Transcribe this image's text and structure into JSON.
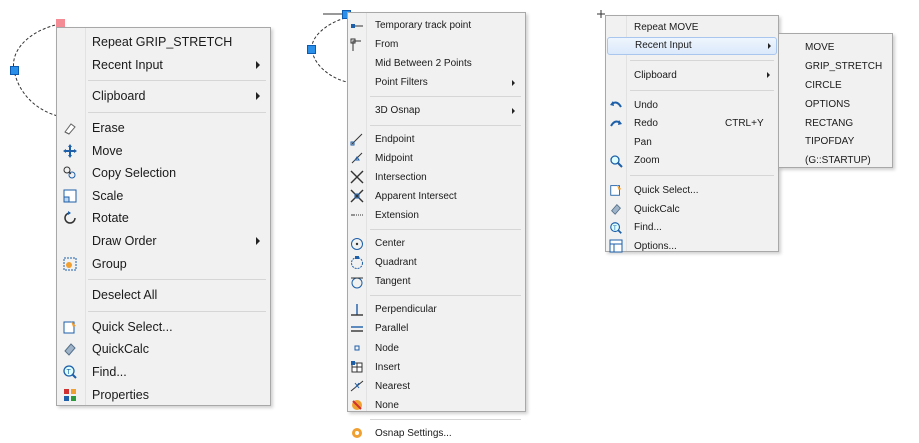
{
  "menu_grip": {
    "items": [
      {
        "type": "item",
        "label": "Repeat GRIP_STRETCH",
        "icon": null
      },
      {
        "type": "item",
        "label": "Recent Input",
        "submenu": true,
        "icon": null
      },
      {
        "type": "separator"
      },
      {
        "type": "item",
        "label": "Clipboard",
        "submenu": true,
        "icon": null
      },
      {
        "type": "separator"
      },
      {
        "type": "item",
        "label": "Erase",
        "icon": "erase-icon"
      },
      {
        "type": "item",
        "label": "Move",
        "icon": "move-icon"
      },
      {
        "type": "item",
        "label": "Copy Selection",
        "icon": "copy-selection-icon"
      },
      {
        "type": "item",
        "label": "Scale",
        "icon": "scale-icon"
      },
      {
        "type": "item",
        "label": "Rotate",
        "icon": "rotate-icon"
      },
      {
        "type": "item",
        "label": "Draw Order",
        "submenu": true,
        "icon": null
      },
      {
        "type": "item",
        "label": "Group",
        "icon": "group-icon"
      },
      {
        "type": "separator"
      },
      {
        "type": "item",
        "label": "Deselect All",
        "icon": null
      },
      {
        "type": "separator"
      },
      {
        "type": "item",
        "label": "Quick Select...",
        "icon": "quick-select-icon"
      },
      {
        "type": "item",
        "label": "QuickCalc",
        "icon": "quickcalc-icon"
      },
      {
        "type": "item",
        "label": "Find...",
        "icon": "find-icon"
      },
      {
        "type": "item",
        "label": "Properties",
        "icon": "properties-icon"
      }
    ]
  },
  "menu_osnap": {
    "items": [
      {
        "type": "item",
        "label": "Temporary track point",
        "icon": "temporary-track-point-icon"
      },
      {
        "type": "item",
        "label": "From",
        "icon": "from-icon"
      },
      {
        "type": "item",
        "label": "Mid Between 2 Points",
        "icon": null
      },
      {
        "type": "item",
        "label": "Point Filters",
        "submenu": true,
        "icon": null
      },
      {
        "type": "separator"
      },
      {
        "type": "item",
        "label": "3D Osnap",
        "submenu": true,
        "icon": null
      },
      {
        "type": "separator"
      },
      {
        "type": "item",
        "label": "Endpoint",
        "icon": "endpoint-icon"
      },
      {
        "type": "item",
        "label": "Midpoint",
        "icon": "midpoint-icon"
      },
      {
        "type": "item",
        "label": "Intersection",
        "icon": "intersection-icon"
      },
      {
        "type": "item",
        "label": "Apparent Intersect",
        "icon": "apparent-intersect-icon"
      },
      {
        "type": "item",
        "label": "Extension",
        "icon": "extension-icon"
      },
      {
        "type": "separator"
      },
      {
        "type": "item",
        "label": "Center",
        "icon": "center-icon"
      },
      {
        "type": "item",
        "label": "Quadrant",
        "icon": "quadrant-icon"
      },
      {
        "type": "item",
        "label": "Tangent",
        "icon": "tangent-icon"
      },
      {
        "type": "separator"
      },
      {
        "type": "item",
        "label": "Perpendicular",
        "icon": "perpendicular-icon"
      },
      {
        "type": "item",
        "label": "Parallel",
        "icon": "parallel-icon"
      },
      {
        "type": "item",
        "label": "Node",
        "icon": "node-icon"
      },
      {
        "type": "item",
        "label": "Insert",
        "icon": "insert-icon"
      },
      {
        "type": "item",
        "label": "Nearest",
        "icon": "nearest-icon"
      },
      {
        "type": "item",
        "label": "None",
        "icon": "none-icon"
      },
      {
        "type": "separator"
      },
      {
        "type": "item",
        "label": "Osnap Settings...",
        "icon": "osnap-settings-icon"
      }
    ]
  },
  "menu_default": {
    "items": [
      {
        "type": "item",
        "label": "Repeat MOVE",
        "icon": null
      },
      {
        "type": "item",
        "label": "Recent Input",
        "submenu": true,
        "highlighted": true,
        "icon": null
      },
      {
        "type": "separator"
      },
      {
        "type": "item",
        "label": "Clipboard",
        "submenu": true,
        "icon": null
      },
      {
        "type": "separator"
      },
      {
        "type": "item",
        "label": "Undo",
        "icon": "undo-icon"
      },
      {
        "type": "item",
        "label": "Redo",
        "shortcut": "CTRL+Y",
        "icon": "redo-icon"
      },
      {
        "type": "item",
        "label": "Pan",
        "icon": null
      },
      {
        "type": "item",
        "label": "Zoom",
        "icon": "zoom-icon"
      },
      {
        "type": "separator"
      },
      {
        "type": "item",
        "label": "Quick Select...",
        "icon": "quick-select-icon"
      },
      {
        "type": "item",
        "label": "QuickCalc",
        "icon": "quickcalc-icon"
      },
      {
        "type": "item",
        "label": "Find...",
        "icon": "find-icon"
      },
      {
        "type": "item",
        "label": "Options...",
        "icon": "options-icon"
      }
    ]
  },
  "submenu_recent_input": {
    "items": [
      "MOVE",
      "GRIP_STRETCH",
      "CIRCLE",
      "OPTIONS",
      "RECTANG",
      "TIPOFDAY",
      "(G::STARTUP)"
    ]
  },
  "colors": {
    "menu_bg": "#f1f1f1",
    "highlight_border": "#a9c6ee",
    "grip_blue": "#2a8fe8",
    "grip_hot": "#f38c95"
  }
}
